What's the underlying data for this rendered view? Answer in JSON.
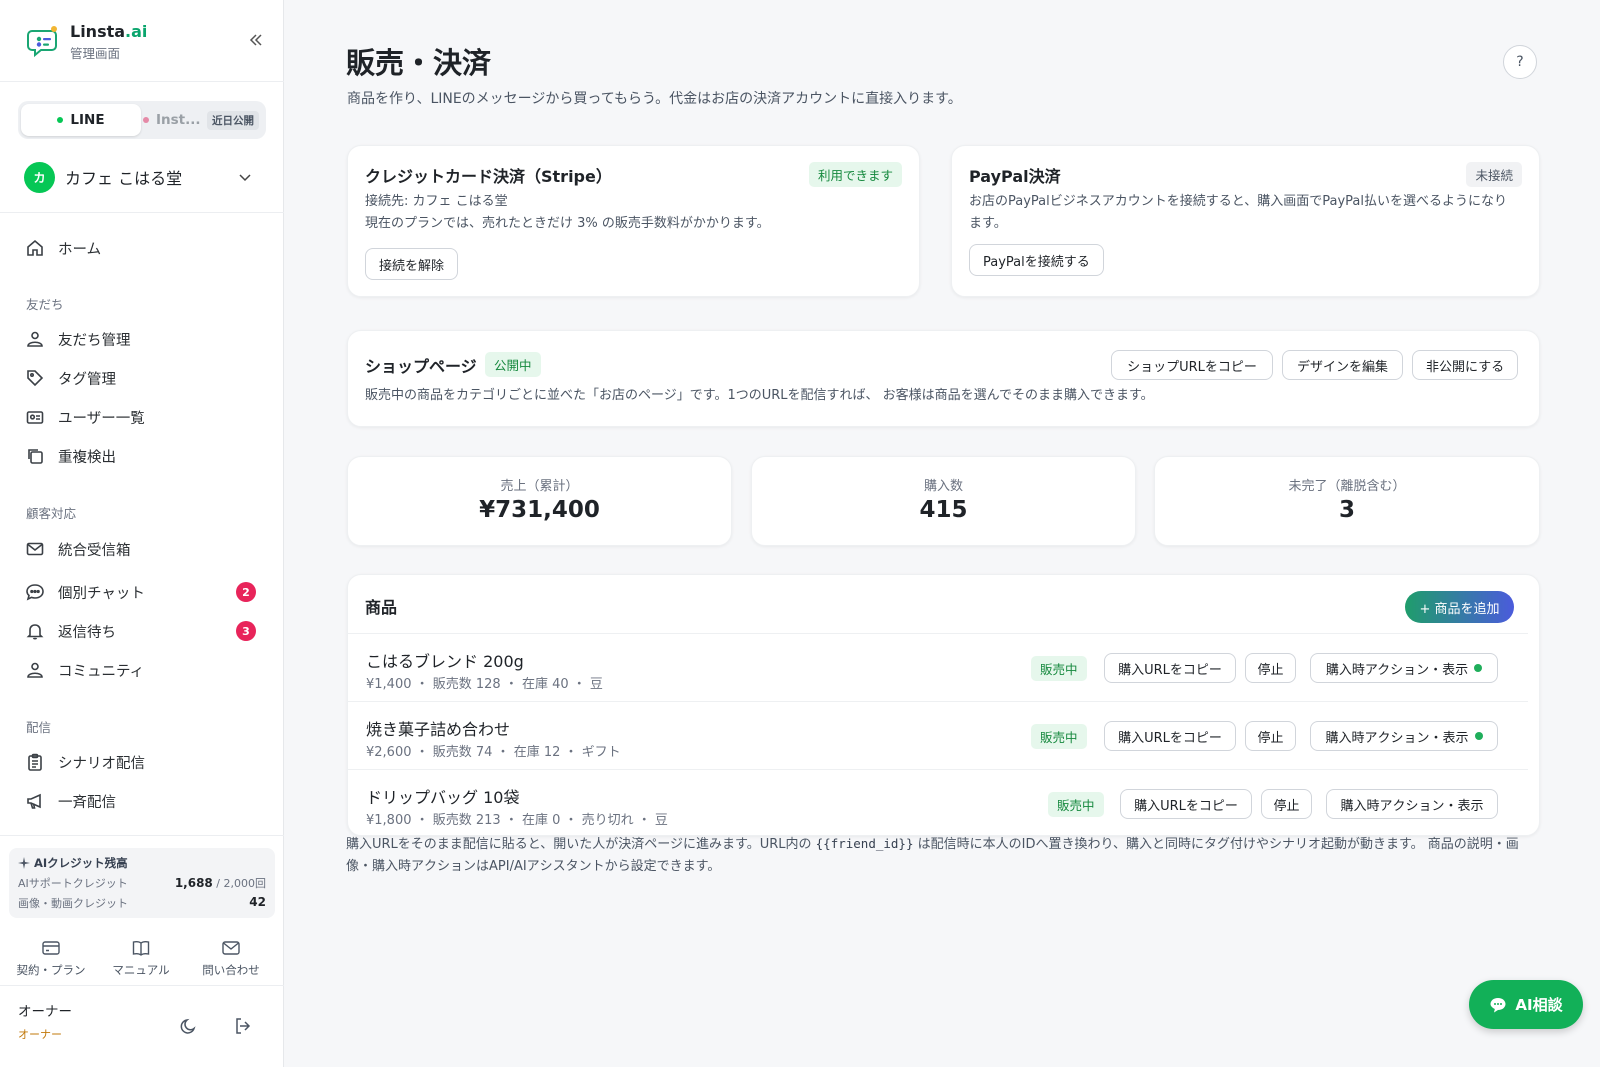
{
  "brand": {
    "name_main": "Linsta",
    "name_ai": ".ai",
    "subtitle": "管理画面"
  },
  "channels": {
    "line": "LINE",
    "instagram": "Inst...",
    "instagram_badge": "近日公開"
  },
  "account": {
    "avatar_text": "カ",
    "name": "カフェ こはる堂"
  },
  "nav": {
    "home": "ホーム",
    "section_friends": "友だち",
    "friends": "友だち管理",
    "tags": "タグ管理",
    "users": "ユーザー一覧",
    "duplicates": "重複検出",
    "section_support": "顧客対応",
    "inbox": "統合受信箱",
    "chat": "個別チャット",
    "chat_badge": "2",
    "pending": "返信待ち",
    "pending_badge": "3",
    "community": "コミュニティ",
    "section_delivery": "配信",
    "scenario": "シナリオ配信",
    "broadcast": "一斉配信"
  },
  "credits": {
    "title": "AIクレジット残高",
    "support_label": "AIサポートクレジット",
    "support_value": "1,688",
    "support_total": " / 2,000回",
    "media_label": "画像・動画クレジット",
    "media_value": "42"
  },
  "quick_links": {
    "plan": "契約・プラン",
    "manual": "マニュアル",
    "contact": "問い合わせ"
  },
  "user": {
    "name": "オーナー",
    "role": "オーナー"
  },
  "page": {
    "title": "販売・決済",
    "subtitle": "商品を作り、LINEのメッセージから買ってもらう。代金はお店の決済アカウントに直接入ります。",
    "help": "?"
  },
  "stripe": {
    "title": "クレジットカード決済（Stripe）",
    "status": "利用できます",
    "connected_to": "接続先: カフェ こはる堂",
    "fee_note": "現在のプランでは、売れたときだけ 3% の販売手数料がかかります。",
    "disconnect": "接続を解除"
  },
  "paypal": {
    "title": "PayPal決済",
    "status": "未接続",
    "description": "お店のPayPalビジネスアカウントを接続すると、購入画面でPayPal払いを選べるようになります。",
    "connect": "PayPalを接続する"
  },
  "shop": {
    "title": "ショップページ",
    "status": "公開中",
    "copy_url": "ショップURLをコピー",
    "edit_design": "デザインを編集",
    "unpublish": "非公開にする",
    "description": "販売中の商品をカテゴリごとに並べた「お店のページ」です。1つのURLを配信すれば、 お客様は商品を選んでそのまま購入できます。"
  },
  "stats": [
    {
      "label": "売上（累計）",
      "value": "¥731,400"
    },
    {
      "label": "購入数",
      "value": "415"
    },
    {
      "label": "未完了（離脱含む）",
      "value": "3"
    }
  ],
  "products": {
    "header": "商品",
    "add": "+ 商品を追加",
    "items": [
      {
        "name": "こはるブレンド 200g",
        "meta": "¥1,400 ・ 販売数 128 ・ 在庫 40 ・ 豆",
        "status": "販売中",
        "copy": "購入URLをコピー",
        "stop": "停止",
        "action": "購入時アクション・表示"
      },
      {
        "name": "焼き菓子詰め合わせ",
        "meta": "¥2,600 ・ 販売数 74 ・ 在庫 12 ・ ギフト",
        "status": "販売中",
        "copy": "購入URLをコピー",
        "stop": "停止",
        "action": "購入時アクション・表示"
      },
      {
        "name": "ドリップバッグ 10袋",
        "meta": "¥1,800 ・ 販売数 213 ・ 在庫 0 ・ 売り切れ ・ 豆",
        "status": "販売中",
        "copy": "購入URLをコピー",
        "stop": "停止",
        "action": "購入時アクション・表示"
      }
    ]
  },
  "footnote": {
    "part1": "購入URLをそのまま配信に貼ると、開いた人が決済ページに進みます。URL内の ",
    "code": "{{friend_id}}",
    "part2": " は配信時に本人のIDへ置き換わり、購入と同時にタグ付けやシナリオ起動が動きます。 商品の説明・画像・購入時アクションはAPI/AIアシスタントから設定できます。"
  },
  "ai_button": "AI相談",
  "colors": {
    "line_green": "#06c755",
    "accent_green": "#12b058",
    "badge_red": "#e8245a",
    "status_dot": "#1fae5b"
  }
}
